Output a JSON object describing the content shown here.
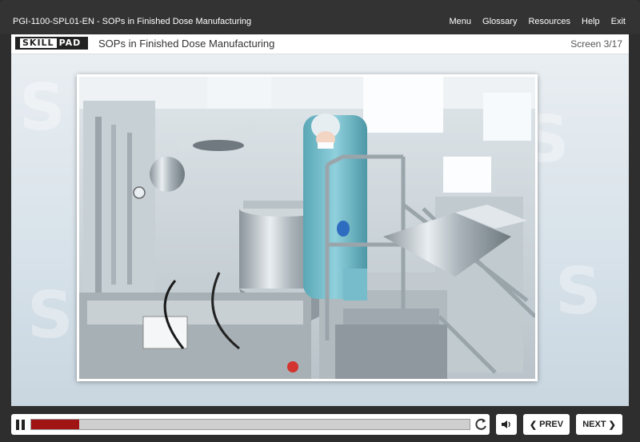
{
  "header": {
    "course_code": "PGI-1100-SPL01-EN - SOPs in Finished Dose Manufacturing",
    "menu": [
      "Menu",
      "Glossary",
      "Resources",
      "Help",
      "Exit"
    ]
  },
  "titlebar": {
    "logo_left": "SKILL",
    "logo_right": "PAD",
    "course_title": "SOPs in Finished Dose Manufacturing",
    "screen_counter": "Screen 3/17"
  },
  "content": {
    "image_subject": "Technician in cleanroom suit operating stainless steel pharmaceutical mixing equipment on a raised platform"
  },
  "player": {
    "progress": 0.11,
    "prev_label": "PREV",
    "next_label": "NEXT",
    "accent_color": "#a01414"
  },
  "icons": [
    "pause-icon",
    "replay-icon",
    "speaker-icon",
    "chevron-left-icon",
    "chevron-right-icon"
  ]
}
